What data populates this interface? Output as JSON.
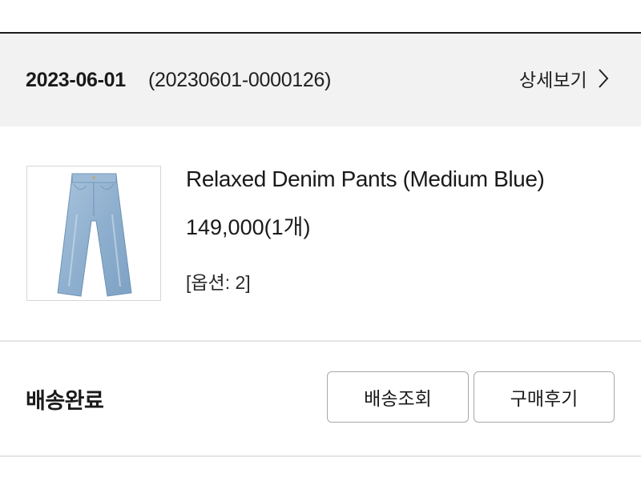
{
  "order": {
    "date": "2023-06-01",
    "number": "(20230601-0000126)",
    "detail_label": "상세보기"
  },
  "product": {
    "name": "Relaxed Denim Pants (Medium Blue)",
    "price": "149,000(1개)",
    "option": "[옵션: 2]",
    "image_icon": "denim-pants-image"
  },
  "status": {
    "label": "배송완료"
  },
  "actions": {
    "track_label": "배송조회",
    "review_label": "구매후기"
  }
}
